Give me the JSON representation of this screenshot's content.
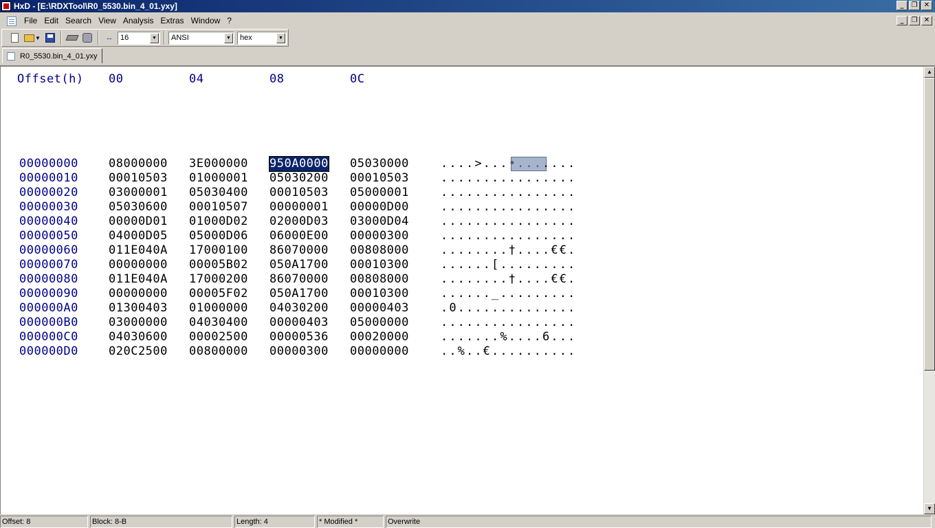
{
  "window": {
    "title": "HxD - [E:\\RDXTool\\R0_5530.bin_4_01.yxy]",
    "title_buttons": [
      "_",
      "❐",
      "✕"
    ]
  },
  "menu": {
    "items": [
      "File",
      "Edit",
      "Search",
      "View",
      "Analysis",
      "Extras",
      "Window",
      "?"
    ],
    "mdi_buttons": [
      "_",
      "❐",
      "✕"
    ]
  },
  "toolbar": {
    "bytes_per_row": "16",
    "charset": "ANSI",
    "offset_base": "hex"
  },
  "tabs": [
    {
      "label": "R0_5530.bin_4_01.yxy",
      "active": true
    }
  ],
  "hex": {
    "header_offset": "Offset(h)",
    "header_cols": [
      "00",
      "04",
      "08",
      "0C"
    ],
    "rows": [
      {
        "offset": "00000000",
        "g": [
          "08000000",
          "3E000000",
          "950A0000",
          "05030000"
        ],
        "ascii": "....>.......",
        "ascii_pre": "....>...",
        "ascii_sel": "•...",
        "ascii_post": "...."
      },
      {
        "offset": "00000010",
        "g": [
          "00010503",
          "01000001",
          "05030200",
          "00010503"
        ],
        "ascii": "................"
      },
      {
        "offset": "00000020",
        "g": [
          "03000001",
          "05030400",
          "00010503",
          "05000001"
        ],
        "ascii": "................"
      },
      {
        "offset": "00000030",
        "g": [
          "05030600",
          "00010507",
          "00000001",
          "00000D00"
        ],
        "ascii": "................"
      },
      {
        "offset": "00000040",
        "g": [
          "00000D01",
          "01000D02",
          "02000D03",
          "03000D04"
        ],
        "ascii": "................"
      },
      {
        "offset": "00000050",
        "g": [
          "04000D05",
          "05000D06",
          "06000E00",
          "00000300"
        ],
        "ascii": "................"
      },
      {
        "offset": "00000060",
        "g": [
          "011E040A",
          "17000100",
          "86070000",
          "00808000"
        ],
        "ascii": "........†....€€."
      },
      {
        "offset": "00000070",
        "g": [
          "00000000",
          "00005B02",
          "050A1700",
          "00010300"
        ],
        "ascii": "......[........."
      },
      {
        "offset": "00000080",
        "g": [
          "011E040A",
          "17000200",
          "86070000",
          "00808000"
        ],
        "ascii": "........†....€€."
      },
      {
        "offset": "00000090",
        "g": [
          "00000000",
          "00005F02",
          "050A1700",
          "00010300"
        ],
        "ascii": "......_........."
      },
      {
        "offset": "000000A0",
        "g": [
          "01300403",
          "01000000",
          "04030200",
          "00000403"
        ],
        "ascii": ".0.............."
      },
      {
        "offset": "000000B0",
        "g": [
          "03000000",
          "04030400",
          "00000403",
          "05000000"
        ],
        "ascii": "................"
      },
      {
        "offset": "000000C0",
        "g": [
          "04030600",
          "00002500",
          "00000536",
          "00020000"
        ],
        "ascii": ".......%....6..."
      },
      {
        "offset": "000000D0",
        "g": [
          "020C2500",
          "00800000",
          "00000300",
          "00000000"
        ],
        "ascii": "..%..€.........."
      }
    ]
  },
  "status": {
    "offset": "Offset: 8",
    "block": "Block: 8-B",
    "length": "Length: 4",
    "modified": "* Modified *",
    "mode": "Overwrite"
  },
  "colors": {
    "title_gradient_start": "#0a246a",
    "title_gradient_end": "#3a6ea5",
    "offset_text": "#00008b",
    "selection_hex": "#0a246a",
    "selection_ascii": "#a6b4cc"
  }
}
